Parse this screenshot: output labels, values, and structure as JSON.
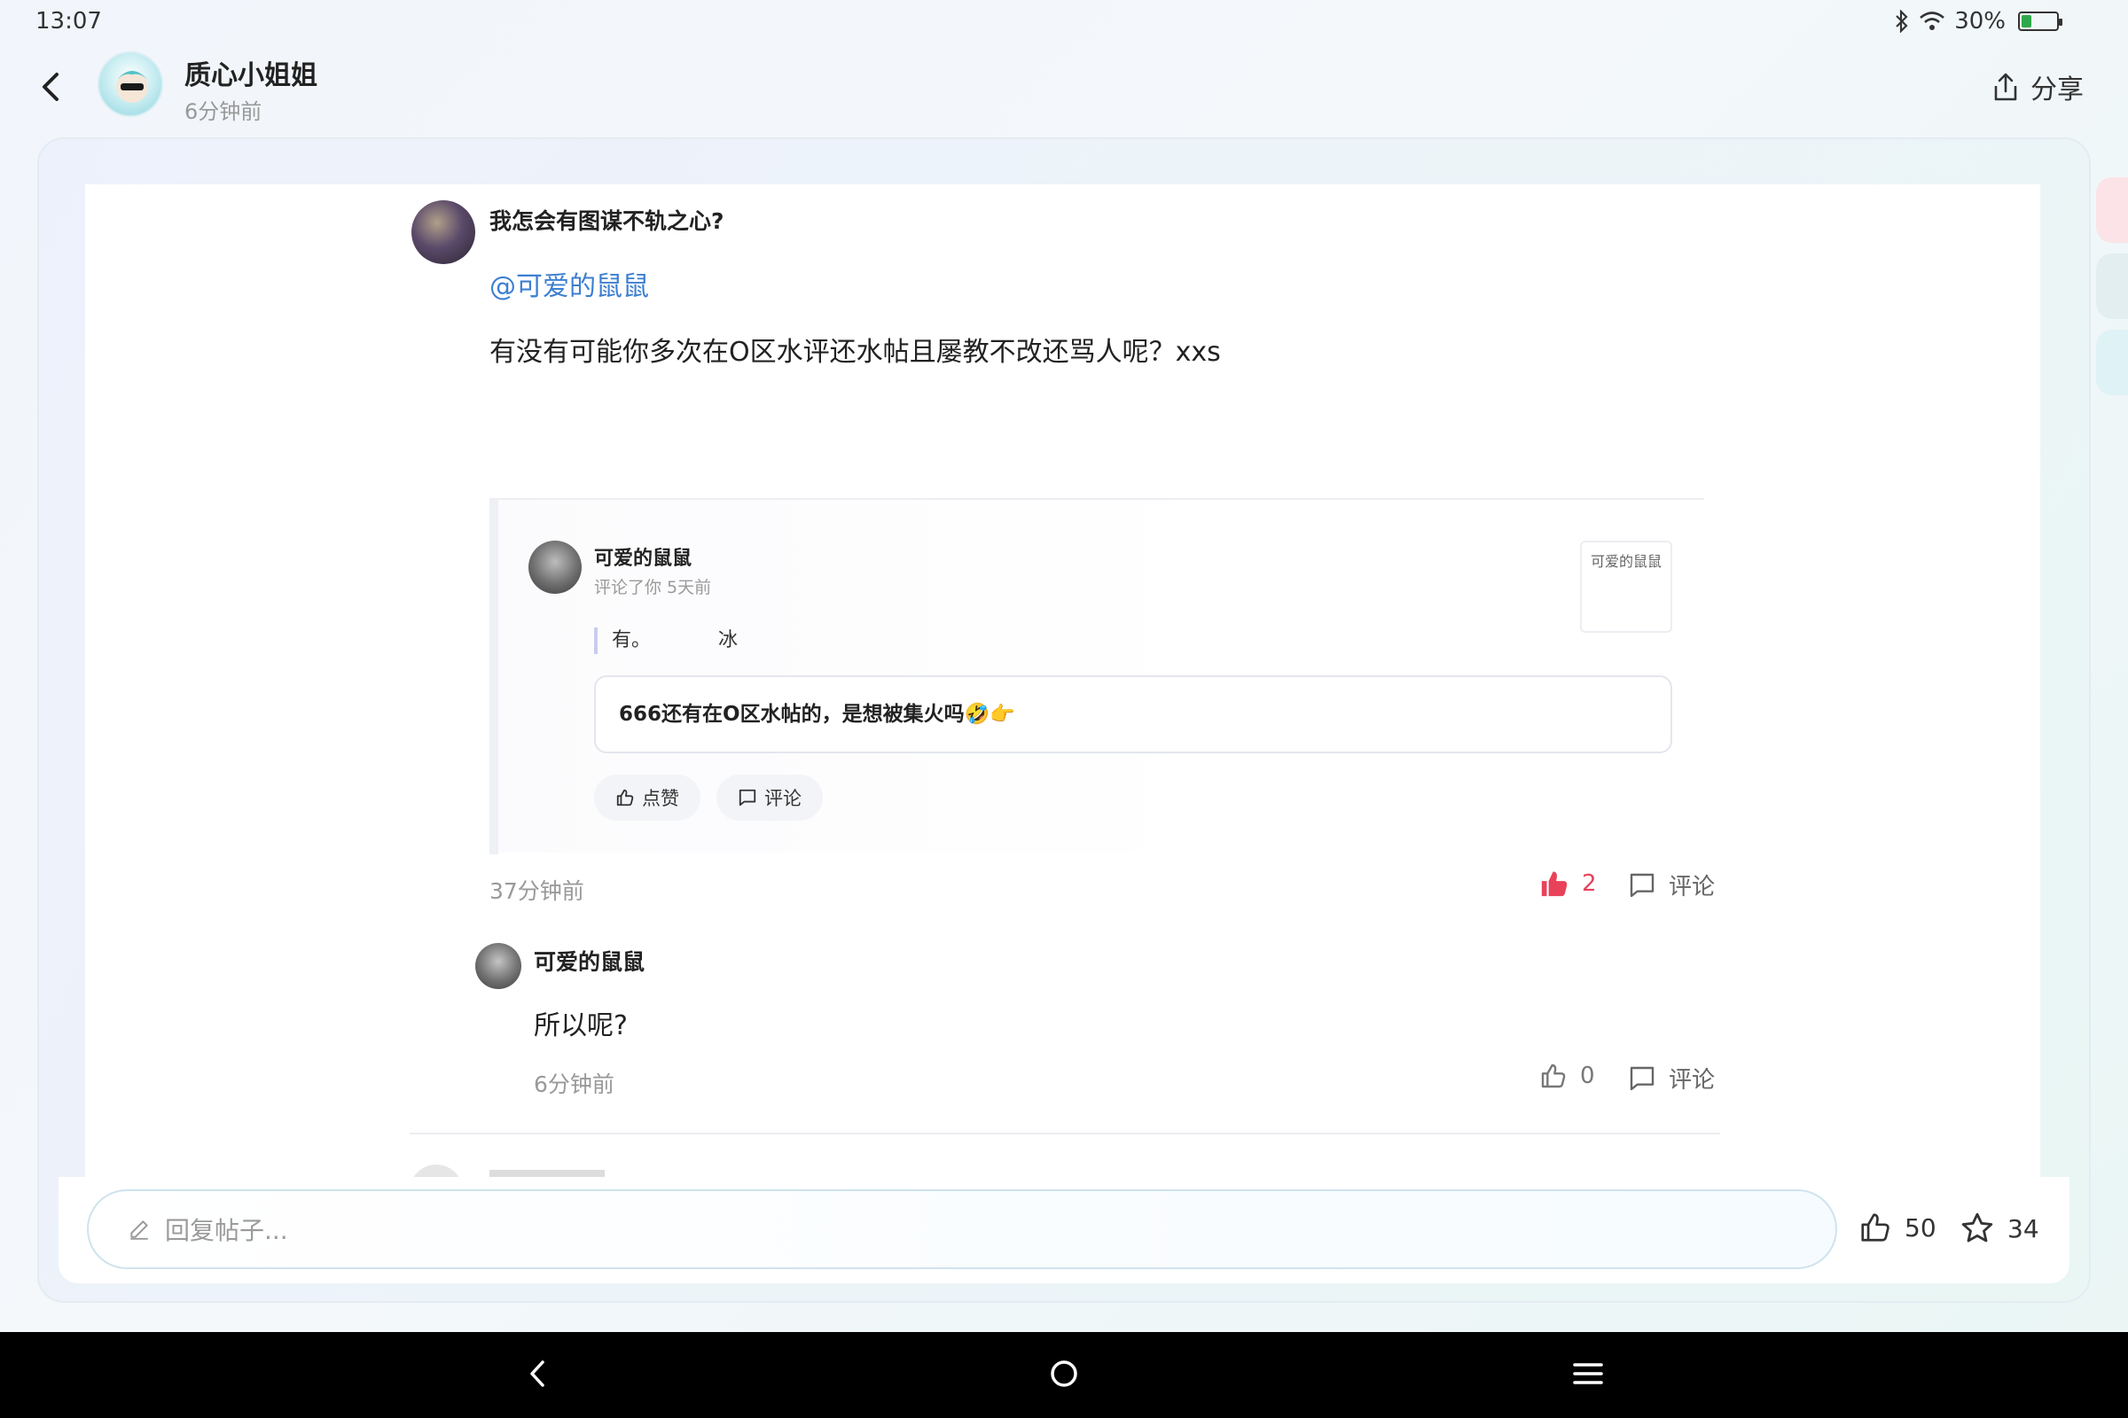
{
  "status_bar": {
    "time": "13:07",
    "battery_text": "30%",
    "battery_level": 0.3,
    "accent_battery": "#2ea84a"
  },
  "header": {
    "author_name": "质心小姐姐",
    "time": "6分钟前",
    "share_label": "分享"
  },
  "comment": {
    "author_name": "我怎会有图谋不轨之心?",
    "mention": "@可爱的鼠鼠",
    "text": "有没有可能你多次在O区水评还水帖且屡教不改还骂人呢？xxs",
    "time": "37分钟前",
    "likes": "2",
    "comment_label": "评论",
    "quoted": {
      "author_name": "可爱的鼠鼠",
      "meta": "评论了你 5天前",
      "excerpt": "有。",
      "excerpt_extra": "冰",
      "thumb_text": "可爱的鼠鼠",
      "reply_text": "666还有在O区水帖的，是想被集火吗🤣👉",
      "like_label": "点赞",
      "comment_label": "评论"
    }
  },
  "reply": {
    "author_name": "可爱的鼠鼠",
    "text": "所以呢?",
    "time": "6分钟前",
    "likes": "0",
    "comment_label": "评论"
  },
  "bottom_bar": {
    "input_placeholder": "回复帖子...",
    "like_count": "50",
    "fav_count": "34"
  },
  "colors": {
    "accent_like": "#e8425a",
    "mention": "#3d7fd0"
  }
}
